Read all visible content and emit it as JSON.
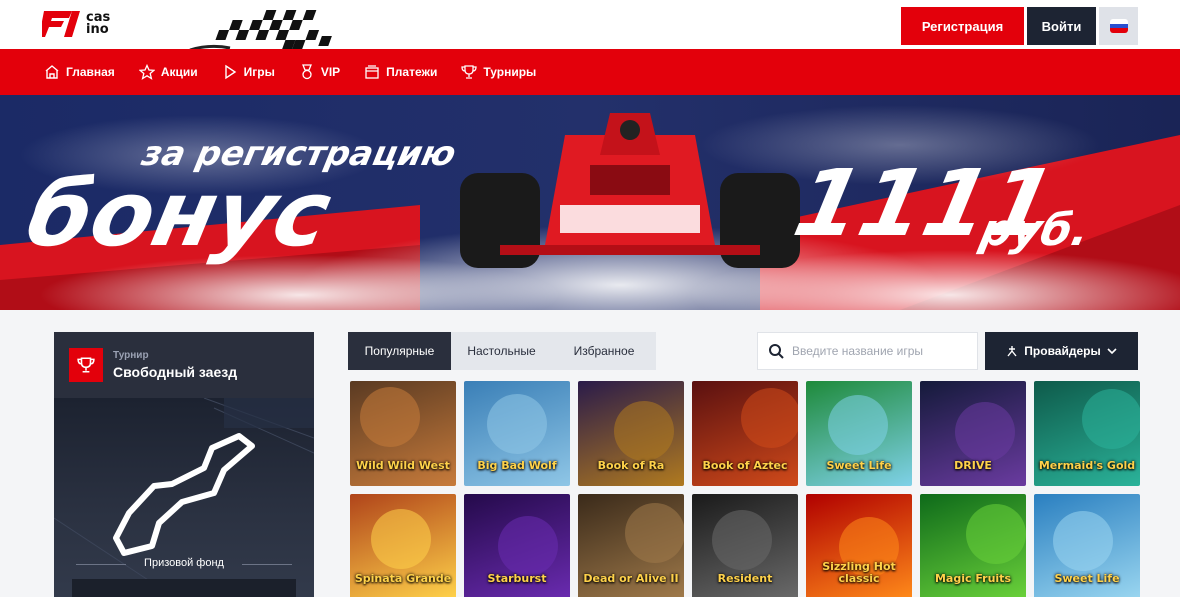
{
  "header": {
    "logo_text_top": "cas",
    "logo_text_bottom": "ino",
    "register_label": "Регистрация",
    "login_label": "Войти",
    "language_flag": "flag-ru-icon"
  },
  "nav": {
    "items": [
      {
        "label": "Главная",
        "icon": "home-icon"
      },
      {
        "label": "Акции",
        "icon": "star-icon"
      },
      {
        "label": "Игры",
        "icon": "play-icon"
      },
      {
        "label": "VIP",
        "icon": "medal-icon"
      },
      {
        "label": "Платежи",
        "icon": "wallet-icon"
      },
      {
        "label": "Турниры",
        "icon": "trophy-icon"
      }
    ]
  },
  "banner": {
    "line1": "за регистрацию",
    "line2": "бонус",
    "amount": "1111",
    "currency": "руб."
  },
  "tournament": {
    "subtitle": "Турнир",
    "title": "Свободный заезд",
    "prize_label": "Призовой фонд"
  },
  "tabs": [
    {
      "label": "Популярные",
      "active": true
    },
    {
      "label": "Настольные",
      "active": false
    },
    {
      "label": "Избранное",
      "active": false
    }
  ],
  "search": {
    "placeholder": "Введите название игры"
  },
  "providers": {
    "label": "Провайдеры"
  },
  "games": [
    {
      "title": "Wild Wild West",
      "bg1": "#5a3a22",
      "bg2": "#c77b3b"
    },
    {
      "title": "Big Bad Wolf",
      "bg1": "#3a7fb7",
      "bg2": "#8fc6e6"
    },
    {
      "title": "Book of Ra",
      "bg1": "#2a1b4a",
      "bg2": "#b07a1f"
    },
    {
      "title": "Book of Aztec",
      "bg1": "#5a1010",
      "bg2": "#d04a1a"
    },
    {
      "title": "Sweet Life",
      "bg1": "#1e8a3a",
      "bg2": "#7fd1e8"
    },
    {
      "title": "DRIVE",
      "bg1": "#141a3a",
      "bg2": "#6a3ba0"
    },
    {
      "title": "Mermaid's Gold",
      "bg1": "#0e5a4a",
      "bg2": "#2bb39a"
    },
    {
      "title": "Spinata Grande",
      "bg1": "#b0441a",
      "bg2": "#ffd24a"
    },
    {
      "title": "Starburst",
      "bg1": "#240a4a",
      "bg2": "#6a2bb0"
    },
    {
      "title": "Dead or Alive II",
      "bg1": "#3a2a1a",
      "bg2": "#a07a4a"
    },
    {
      "title": "Resident",
      "bg1": "#1a1a1a",
      "bg2": "#6a6a6a"
    },
    {
      "title": "Sizzling Hot classic",
      "bg1": "#b00000",
      "bg2": "#ff8a1a"
    },
    {
      "title": "Magic Fruits",
      "bg1": "#0e6a1a",
      "bg2": "#6ad13a"
    },
    {
      "title": "Sweet Life",
      "bg1": "#2a7fc0",
      "bg2": "#9ad6f0"
    }
  ]
}
